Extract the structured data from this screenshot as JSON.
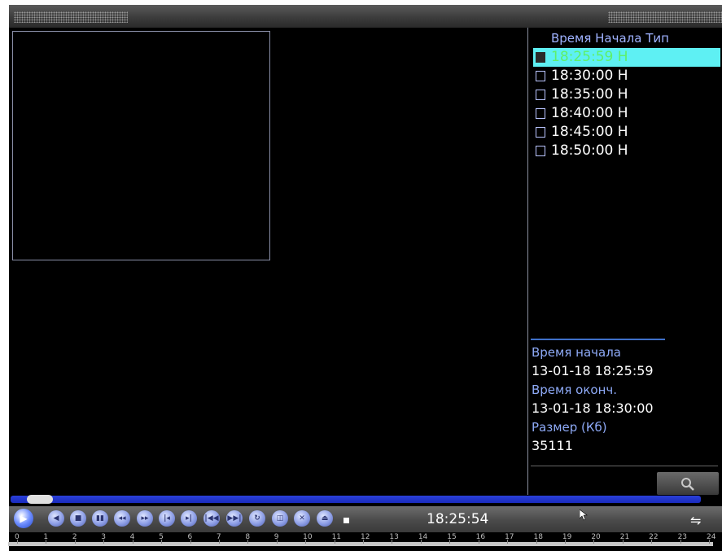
{
  "file_list": {
    "header": "Время Начала Тип",
    "rows": [
      {
        "time": "18:25:59",
        "type": "H",
        "selected": true
      },
      {
        "time": "18:30:00",
        "type": "H",
        "selected": false
      },
      {
        "time": "18:35:00",
        "type": "H",
        "selected": false
      },
      {
        "time": "18:40:00",
        "type": "H",
        "selected": false
      },
      {
        "time": "18:45:00",
        "type": "H",
        "selected": false
      },
      {
        "time": "18:50:00",
        "type": "H",
        "selected": false
      }
    ]
  },
  "file_info": {
    "start_label": "Время начала",
    "start_value": "13-01-18 18:25:59",
    "end_label": "Время оконч.",
    "end_value": "13-01-18 18:30:00",
    "size_label": "Размер (Кб)",
    "size_value": "35111"
  },
  "search_button": {
    "icon": "search-icon"
  },
  "playback": {
    "current_time": "18:25:54",
    "progress": 0.02,
    "buttons": [
      {
        "name": "play-icon",
        "glyph": "▶"
      },
      {
        "name": "reverse-play-icon",
        "glyph": "◀"
      },
      {
        "name": "stop-icon",
        "glyph": "■"
      },
      {
        "name": "pause-icon",
        "glyph": "▮▮"
      },
      {
        "name": "slow-play-icon",
        "glyph": "◂◂"
      },
      {
        "name": "fast-play-icon",
        "glyph": "▸▸"
      },
      {
        "name": "frame-back-icon",
        "glyph": "|◂"
      },
      {
        "name": "frame-forward-icon",
        "glyph": "▸|"
      },
      {
        "name": "prev-file-icon",
        "glyph": "|◀◀"
      },
      {
        "name": "next-file-icon",
        "glyph": "▶▶|"
      },
      {
        "name": "repeat-icon",
        "glyph": "↻"
      },
      {
        "name": "clip-icon",
        "glyph": "◫"
      },
      {
        "name": "close-icon",
        "glyph": "✕"
      },
      {
        "name": "eject-icon",
        "glyph": "⏏"
      }
    ]
  },
  "timeline": {
    "hours": [
      "0",
      "1",
      "2",
      "3",
      "4",
      "5",
      "6",
      "7",
      "8",
      "9",
      "10",
      "11",
      "12",
      "13",
      "14",
      "15",
      "16",
      "17",
      "18",
      "19",
      "20",
      "21",
      "22",
      "23",
      "24"
    ]
  },
  "colors": {
    "selected_row": "#5ef0f3",
    "selected_text": "#5ef06a",
    "label_blue": "#8eaaf7",
    "progress_blue": "#2a3fd8"
  }
}
